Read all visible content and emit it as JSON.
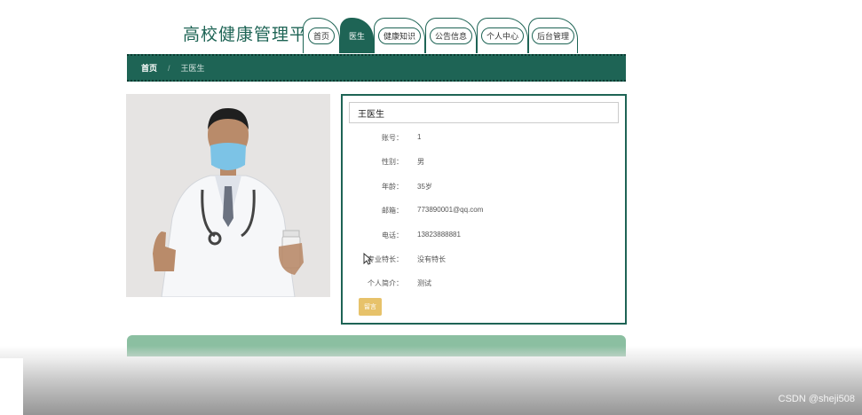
{
  "header": {
    "site_title": "高校健康管理平台",
    "nav": [
      {
        "label": "首页",
        "active": false
      },
      {
        "label": "医生",
        "active": true
      },
      {
        "label": "健康知识",
        "active": false
      },
      {
        "label": "公告信息",
        "active": false
      },
      {
        "label": "个人中心",
        "active": false
      },
      {
        "label": "后台管理",
        "active": false
      }
    ]
  },
  "breadcrumb": {
    "home": "首页",
    "separator": "/",
    "current": "王医生"
  },
  "doctor": {
    "title": "王医生",
    "fields": [
      {
        "label": "账号：",
        "value": "1"
      },
      {
        "label": "性别：",
        "value": "男"
      },
      {
        "label": "年龄：",
        "value": "35岁"
      },
      {
        "label": "邮箱：",
        "value": "773890001@qq.com"
      },
      {
        "label": "电话：",
        "value": "13823888881"
      },
      {
        "label": "专业特长：",
        "value": "没有特长"
      },
      {
        "label": "个人简介：",
        "value": "测试"
      }
    ],
    "message_button": "留言"
  },
  "watermark": "CSDN @sheji508",
  "colors": {
    "primary": "#1e6455",
    "accent_button": "#e7c26a",
    "panel": "#8bbfa1"
  }
}
